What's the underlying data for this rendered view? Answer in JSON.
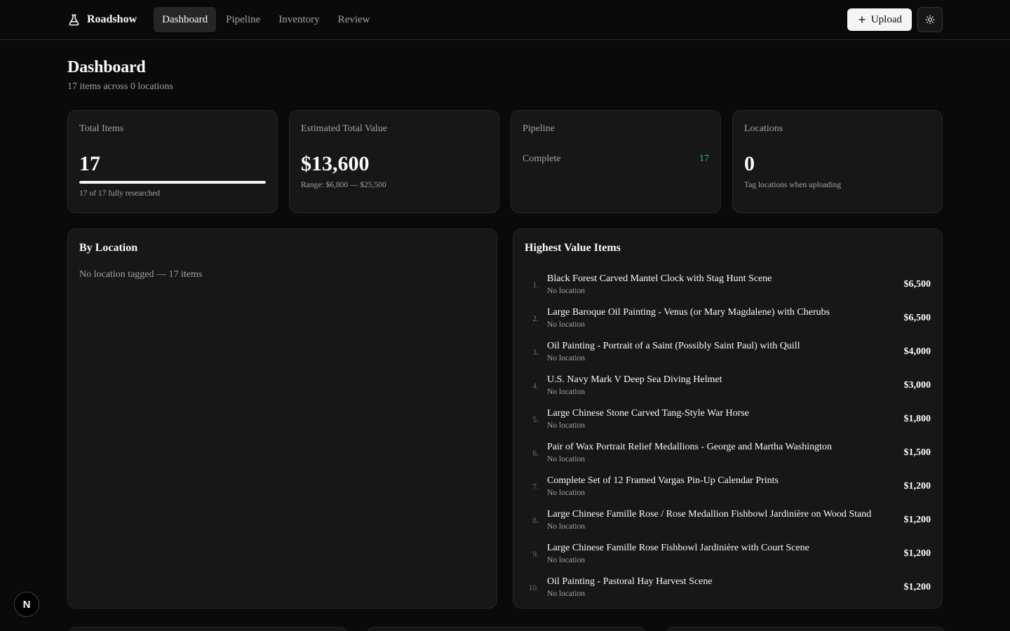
{
  "brand": {
    "name": "Roadshow",
    "icon": "flask-icon"
  },
  "nav": [
    {
      "label": "Dashboard",
      "active": true
    },
    {
      "label": "Pipeline",
      "active": false
    },
    {
      "label": "Inventory",
      "active": false
    },
    {
      "label": "Review",
      "active": false
    }
  ],
  "toolbar": {
    "upload_label": "Upload",
    "upload_icon": "plus-icon",
    "theme_icon": "sun-icon"
  },
  "page": {
    "title": "Dashboard",
    "subtitle": "17 items across 0 locations"
  },
  "stats": {
    "total_items": {
      "label": "Total Items",
      "value": "17",
      "progress_fraction": 1.0,
      "note": "17 of 17 fully researched"
    },
    "estimated_value": {
      "label": "Estimated Total Value",
      "value": "$13,600",
      "note": "Range: $6,800 — $25,500"
    },
    "pipeline": {
      "label": "Pipeline",
      "row_label": "Complete",
      "row_count": "17",
      "accent": "#22c55e"
    },
    "locations": {
      "label": "Locations",
      "value": "0",
      "note": "Tag locations when uploading"
    }
  },
  "by_location": {
    "title": "By Location",
    "line": "No location tagged — 17 items"
  },
  "highest_value": {
    "title": "Highest Value Items",
    "items": [
      {
        "rank": "1.",
        "name": "Black Forest Carved Mantel Clock with Stag Hunt Scene",
        "location": "No location",
        "price": "$6,500"
      },
      {
        "rank": "2.",
        "name": "Large Baroque Oil Painting - Venus (or Mary Magdalene) with Cherubs",
        "location": "No location",
        "price": "$6,500"
      },
      {
        "rank": "3.",
        "name": "Oil Painting - Portrait of a Saint (Possibly Saint Paul) with Quill",
        "location": "No location",
        "price": "$4,000"
      },
      {
        "rank": "4.",
        "name": "U.S. Navy Mark V Deep Sea Diving Helmet",
        "location": "No location",
        "price": "$3,000"
      },
      {
        "rank": "5.",
        "name": "Large Chinese Stone Carved Tang-Style War Horse",
        "location": "No location",
        "price": "$1,800"
      },
      {
        "rank": "6.",
        "name": "Pair of Wax Portrait Relief Medallions - George and Martha Washington",
        "location": "No location",
        "price": "$1,500"
      },
      {
        "rank": "7.",
        "name": "Complete Set of 12 Framed Vargas Pin-Up Calendar Prints",
        "location": "No location",
        "price": "$1,200"
      },
      {
        "rank": "8.",
        "name": "Large Chinese Famille Rose / Rose Medallion Fishbowl Jardinière on Wood Stand",
        "location": "No location",
        "price": "$1,200"
      },
      {
        "rank": "9.",
        "name": "Large Chinese Famille Rose Fishbowl Jardinière with Court Scene",
        "location": "No location",
        "price": "$1,200"
      },
      {
        "rank": "10.",
        "name": "Oil Painting - Pastoral Hay Harvest Scene",
        "location": "No location",
        "price": "$1,200"
      }
    ]
  },
  "dev_badge": {
    "letter": "N"
  }
}
